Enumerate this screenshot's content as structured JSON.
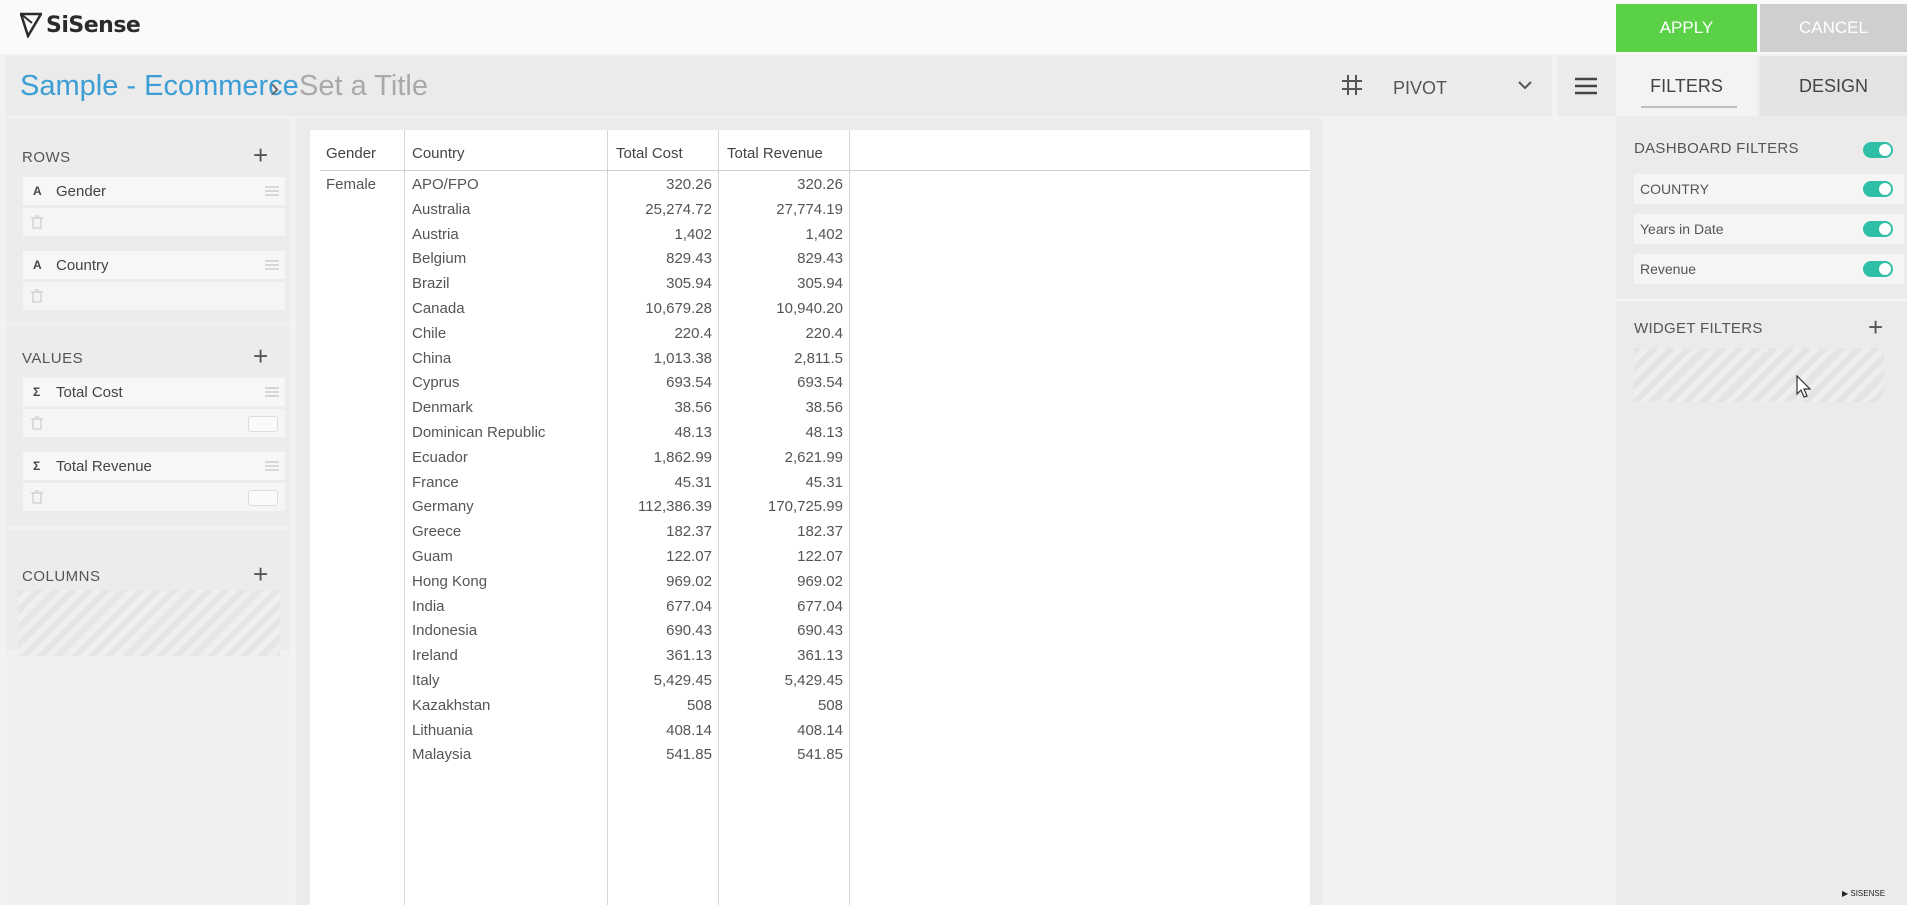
{
  "app": {
    "logo_text": "SiSense"
  },
  "actions": {
    "apply_label": "APPLY",
    "cancel_label": "CANCEL"
  },
  "breadcrumb": {
    "datasource": "Sample - Ecommerce",
    "separator": "›",
    "title_placeholder": "Set a Title"
  },
  "widget_type": {
    "label": "PIVOT",
    "icon": "grid-icon"
  },
  "left_panel": {
    "rows": {
      "title": "ROWS",
      "fields": [
        {
          "type": "A",
          "name": "Gender"
        },
        {
          "type": "A",
          "name": "Country"
        }
      ]
    },
    "values": {
      "title": "VALUES",
      "fields": [
        {
          "type": "Σ",
          "name": "Total Cost"
        },
        {
          "type": "Σ",
          "name": "Total Revenue"
        }
      ]
    },
    "columns": {
      "title": "COLUMNS"
    }
  },
  "pivot": {
    "headers": [
      "Gender",
      "Country",
      "Total Cost",
      "Total Revenue"
    ],
    "gender": "Female",
    "rows": [
      [
        "APO/FPO",
        "320.26",
        "320.26"
      ],
      [
        "Australia",
        "25,274.72",
        "27,774.19"
      ],
      [
        "Austria",
        "1,402",
        "1,402"
      ],
      [
        "Belgium",
        "829.43",
        "829.43"
      ],
      [
        "Brazil",
        "305.94",
        "305.94"
      ],
      [
        "Canada",
        "10,679.28",
        "10,940.20"
      ],
      [
        "Chile",
        "220.4",
        "220.4"
      ],
      [
        "China",
        "1,013.38",
        "2,811.5"
      ],
      [
        "Cyprus",
        "693.54",
        "693.54"
      ],
      [
        "Denmark",
        "38.56",
        "38.56"
      ],
      [
        "Dominican Republic",
        "48.13",
        "48.13"
      ],
      [
        "Ecuador",
        "1,862.99",
        "2,621.99"
      ],
      [
        "France",
        "45.31",
        "45.31"
      ],
      [
        "Germany",
        "112,386.39",
        "170,725.99"
      ],
      [
        "Greece",
        "182.37",
        "182.37"
      ],
      [
        "Guam",
        "122.07",
        "122.07"
      ],
      [
        "Hong Kong",
        "969.02",
        "969.02"
      ],
      [
        "India",
        "677.04",
        "677.04"
      ],
      [
        "Indonesia",
        "690.43",
        "690.43"
      ],
      [
        "Ireland",
        "361.13",
        "361.13"
      ],
      [
        "Italy",
        "5,429.45",
        "5,429.45"
      ],
      [
        "Kazakhstan",
        "508",
        "508"
      ],
      [
        "Lithuania",
        "408.14",
        "408.14"
      ],
      [
        "Malaysia",
        "541.85",
        "541.85"
      ]
    ]
  },
  "right_panel": {
    "tabs": [
      "FILTERS",
      "DESIGN"
    ],
    "dashboard_filters_title": "DASHBOARD FILTERS",
    "dashboard_filters": [
      "COUNTRY",
      "Years in Date",
      "Revenue"
    ],
    "widget_filters_title": "WIDGET FILTERS"
  },
  "colors": {
    "accent": "#3d9ed6",
    "apply": "#5bd147",
    "toggle_on": "#2fbfa6"
  }
}
